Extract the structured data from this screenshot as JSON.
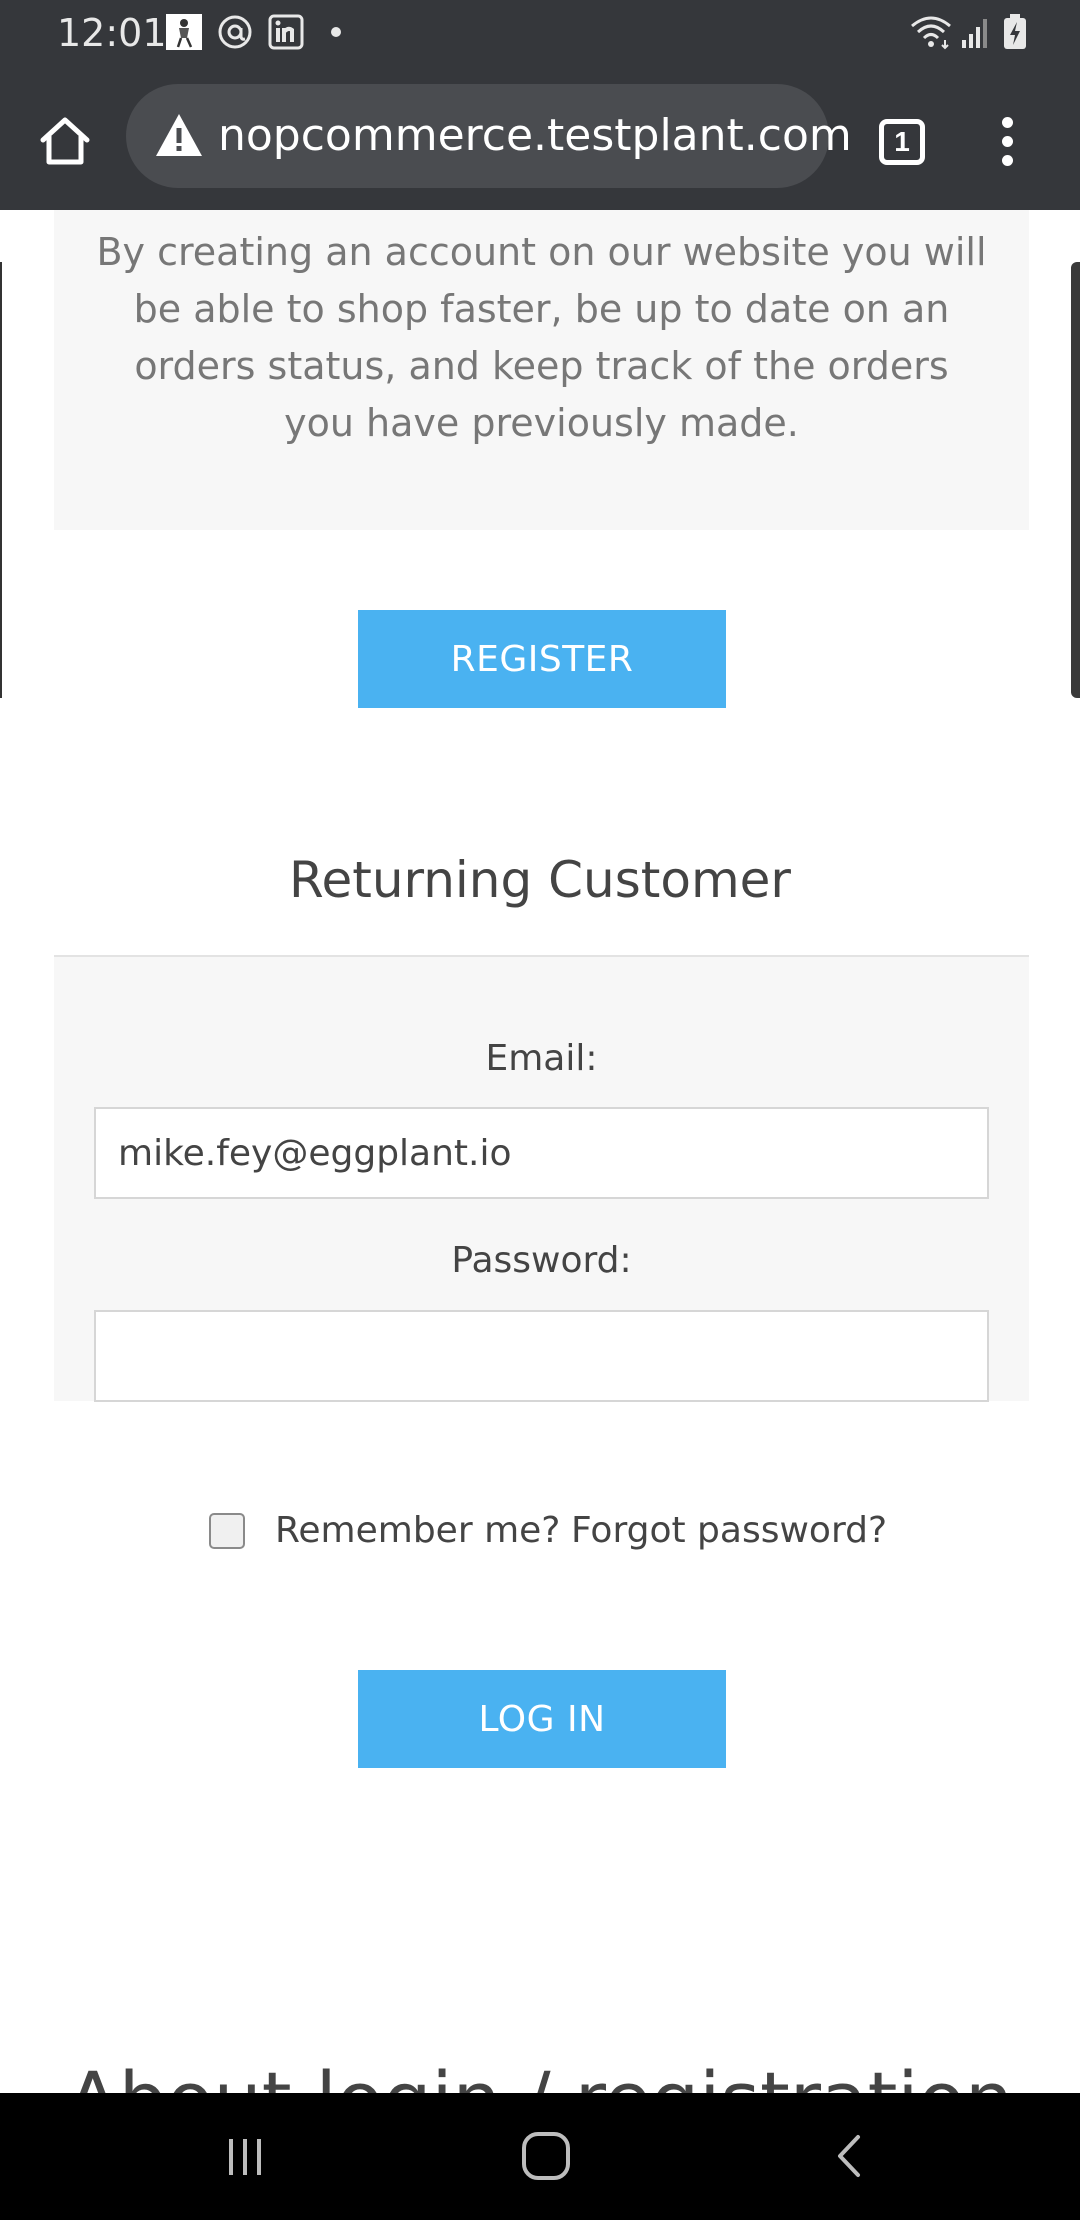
{
  "status_bar": {
    "time": "12:01",
    "notification_icons": [
      "app-figure-icon",
      "threads-icon",
      "linkedin-icon",
      "dot-icon"
    ],
    "right_icons": [
      "wifi-icon",
      "signal-icon",
      "battery-charging-icon"
    ]
  },
  "browser": {
    "url": "nopcommerce.testplant.com",
    "tab_count": "1",
    "security_icon": "warning-icon"
  },
  "register": {
    "description": "By creating an account on our website you will be able to shop faster, be up to date on an orders status, and keep track of the orders you have previously made.",
    "button_label": "REGISTER"
  },
  "returning_customer": {
    "title": "Returning Customer",
    "email_label": "Email:",
    "email_value": "mike.fey@eggplant.io",
    "password_label": "Password:",
    "password_value": "",
    "remember_label": "Remember me?",
    "remember_checked": false,
    "forgot_label": "Forgot password?",
    "login_label": "LOG IN"
  },
  "below_fold": {
    "heading": "About login / registration"
  },
  "colors": {
    "button_blue": "#4ab2f1",
    "panel_gray": "#f7f7f7",
    "chrome_dark": "#35373b"
  }
}
